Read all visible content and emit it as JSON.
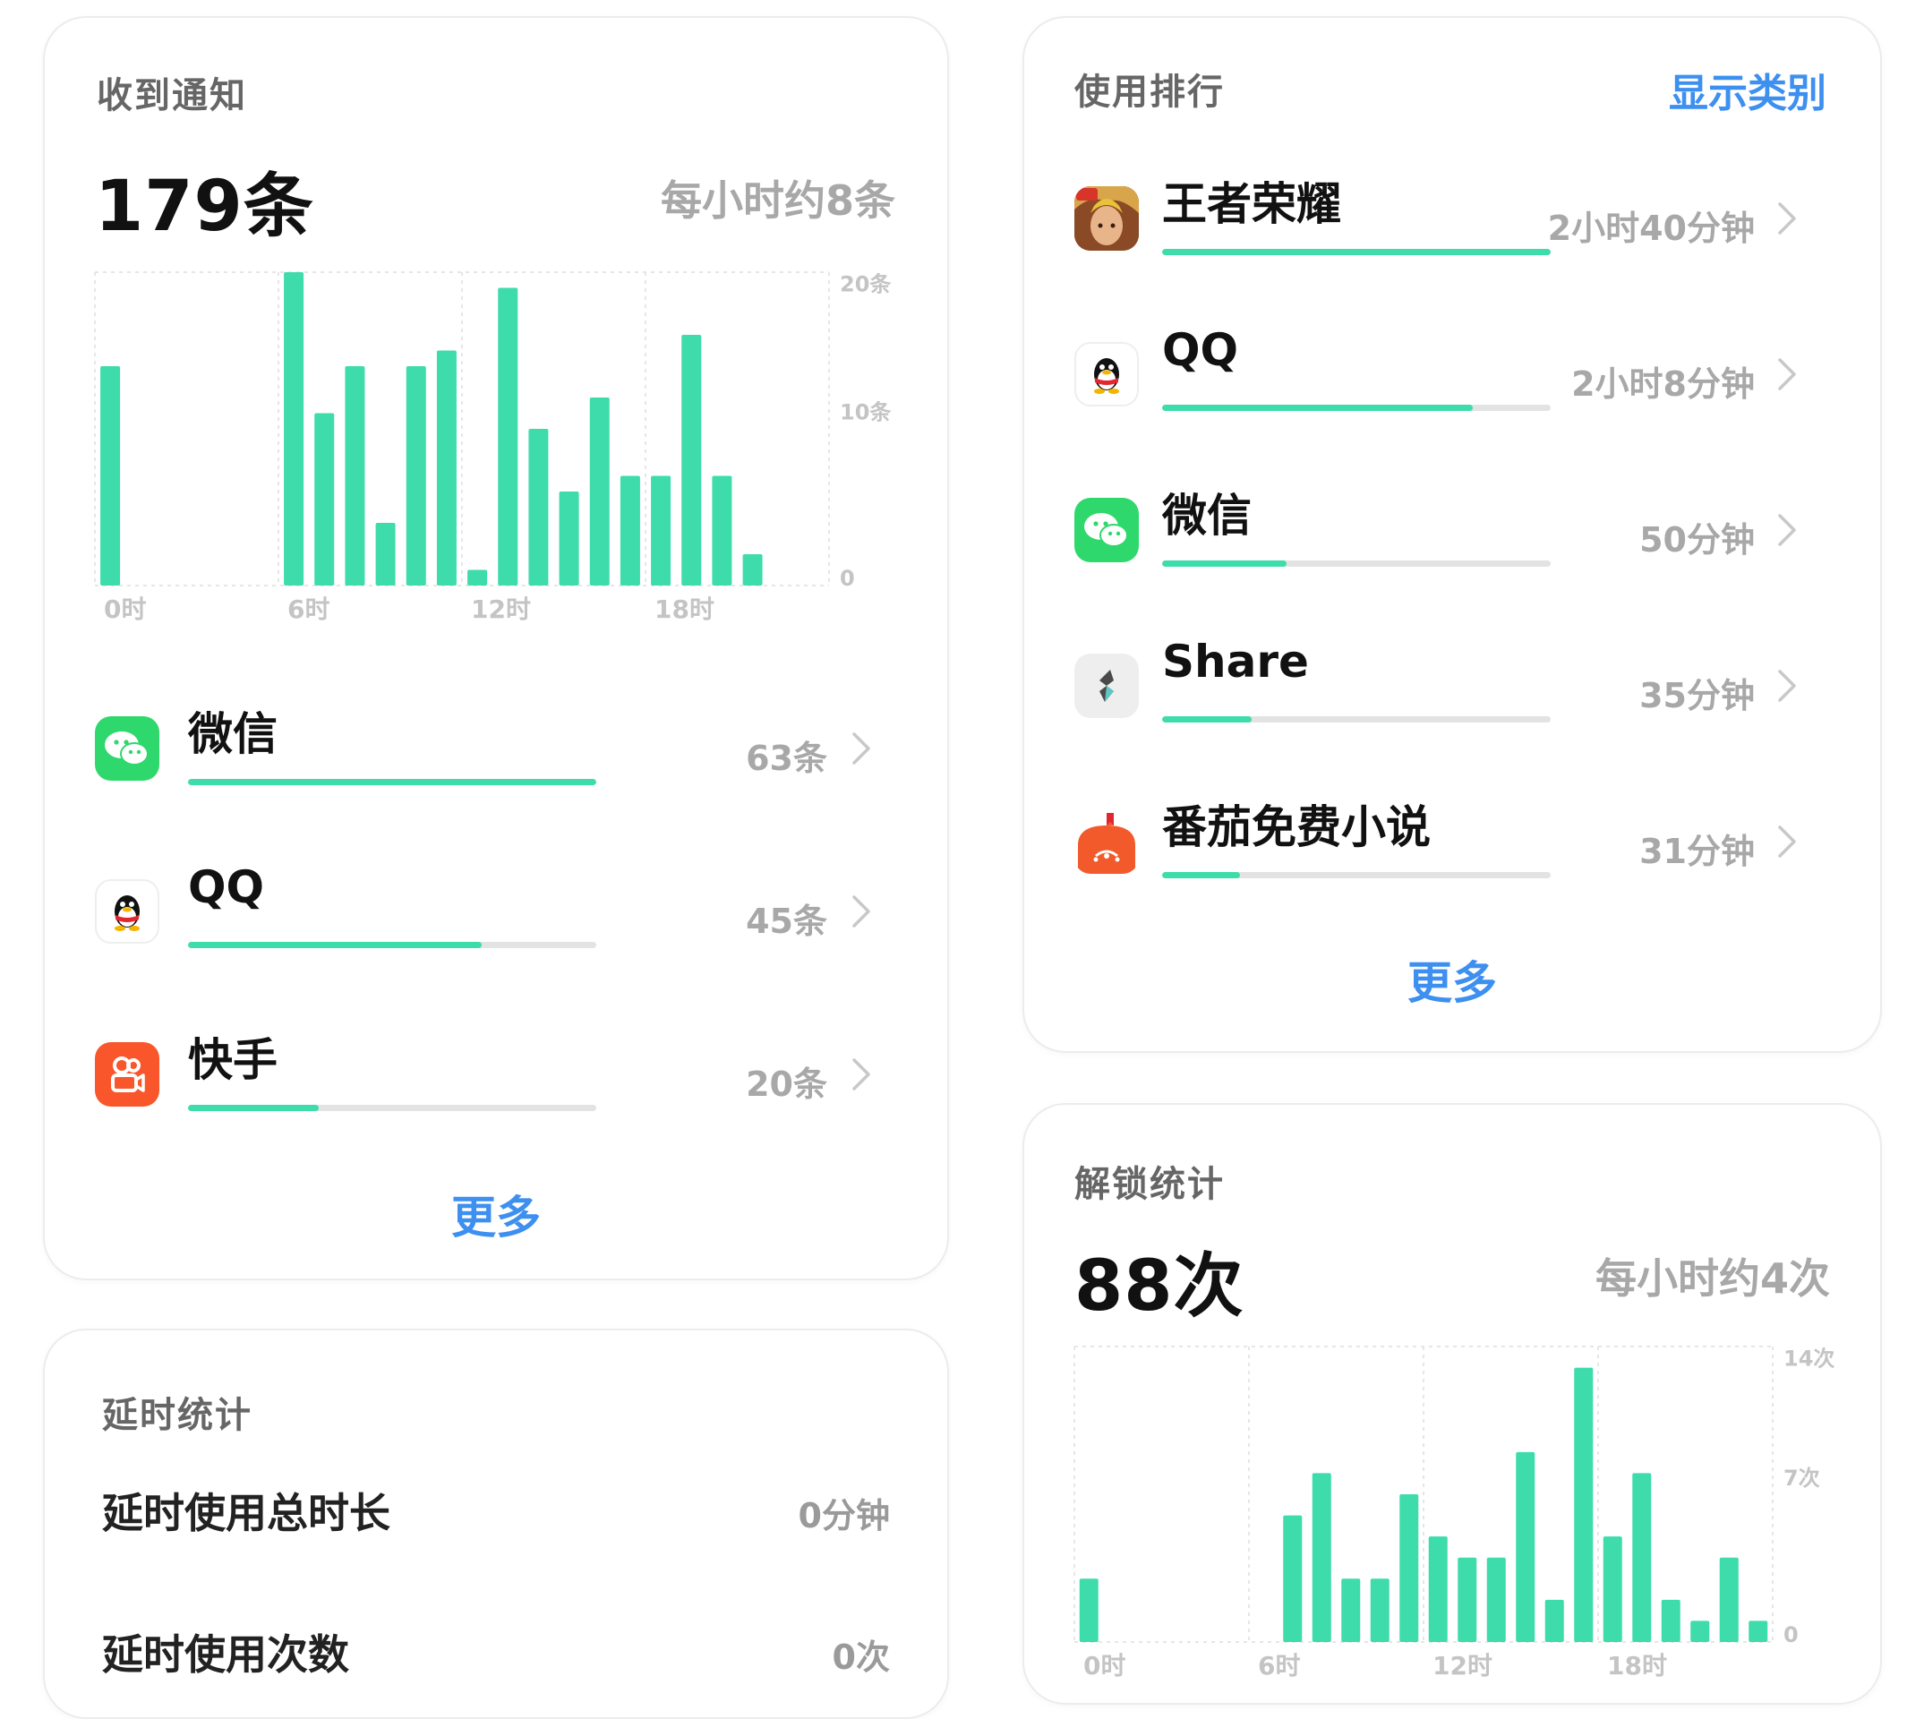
{
  "notifications": {
    "title": "收到通知",
    "total": "179条",
    "average": "每小时约8条",
    "more": "更多",
    "apps": [
      {
        "name": "微信",
        "value": "63条",
        "fraction": 1.0,
        "icon": "wechat-icon"
      },
      {
        "name": "QQ",
        "value": "45条",
        "fraction": 0.72,
        "icon": "qq-icon"
      },
      {
        "name": "快手",
        "value": "20条",
        "fraction": 0.32,
        "icon": "kuaishou-icon"
      }
    ],
    "chart_data": {
      "type": "bar",
      "categories": [
        "0",
        "1",
        "2",
        "3",
        "4",
        "5",
        "6",
        "7",
        "8",
        "9",
        "10",
        "11",
        "12",
        "13",
        "14",
        "15",
        "16",
        "17",
        "18",
        "19",
        "20",
        "21",
        "22",
        "23"
      ],
      "values": [
        14,
        0,
        0,
        0,
        0,
        0,
        20,
        11,
        14,
        4,
        14,
        15,
        1,
        19,
        10,
        6,
        12,
        7,
        7,
        16,
        7,
        2,
        0,
        0
      ],
      "x_tick_labels": [
        "0时",
        "6时",
        "12时",
        "18时"
      ],
      "y_tick_labels": [
        "20条",
        "10条",
        "0"
      ],
      "ylim": [
        0,
        20
      ],
      "color": "#3ddcaa"
    }
  },
  "delay": {
    "title": "延时统计",
    "total_time_label": "延时使用总时长",
    "total_time_value": "0分钟",
    "count_label": "延时使用次数",
    "count_value": "0次"
  },
  "ranking": {
    "title": "使用排行",
    "show_category": "显示类别",
    "more": "更多",
    "apps": [
      {
        "name": "王者荣耀",
        "value": "2小时40分钟",
        "fraction": 1.0,
        "icon": "honor-of-kings-icon"
      },
      {
        "name": "QQ",
        "value": "2小时8分钟",
        "fraction": 0.8,
        "icon": "qq-icon"
      },
      {
        "name": "微信",
        "value": "50分钟",
        "fraction": 0.32,
        "icon": "wechat-icon"
      },
      {
        "name": "Share",
        "value": "35分钟",
        "fraction": 0.23,
        "icon": "share-icon"
      },
      {
        "name": "番茄免费小说",
        "value": "31分钟",
        "fraction": 0.2,
        "icon": "tomato-novel-icon"
      }
    ]
  },
  "unlock": {
    "title": "解锁统计",
    "total": "88次",
    "average": "每小时约4次",
    "chart_data": {
      "type": "bar",
      "categories": [
        "0",
        "1",
        "2",
        "3",
        "4",
        "5",
        "6",
        "7",
        "8",
        "9",
        "10",
        "11",
        "12",
        "13",
        "14",
        "15",
        "16",
        "17",
        "18",
        "19",
        "20",
        "21",
        "22",
        "23"
      ],
      "values": [
        3,
        0,
        0,
        0,
        0,
        0,
        0,
        6,
        8,
        3,
        3,
        7,
        5,
        4,
        4,
        9,
        2,
        13,
        5,
        8,
        2,
        1,
        4,
        1
      ],
      "x_tick_labels": [
        "0时",
        "6时",
        "12时",
        "18时"
      ],
      "y_tick_labels": [
        "14次",
        "7次",
        "0"
      ],
      "ylim": [
        0,
        14
      ],
      "color": "#3ddcaa"
    }
  }
}
